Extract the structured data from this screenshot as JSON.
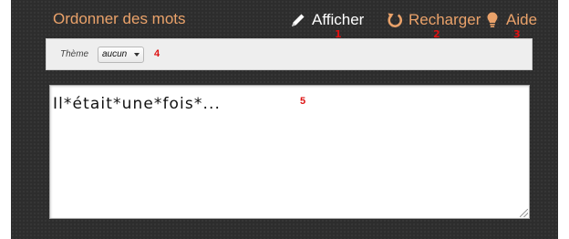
{
  "app": {
    "title": "Ordonner des mots"
  },
  "nav": {
    "afficher": {
      "label": "Afficher",
      "number": "1",
      "icon": "pencil-icon"
    },
    "recharger": {
      "label": "Recharger",
      "number": "2",
      "icon": "reload-icon"
    },
    "aide": {
      "label": "Aide",
      "number": "3",
      "icon": "lightbulb-icon"
    }
  },
  "options": {
    "theme_label": "Thème",
    "theme_value": "aucun",
    "number": "4"
  },
  "editor": {
    "text": "Il*était*une*fois*...",
    "number": "5"
  },
  "colors": {
    "background": "#2d2d2d",
    "accent": "#eaa26a",
    "marker": "#dd1111"
  }
}
